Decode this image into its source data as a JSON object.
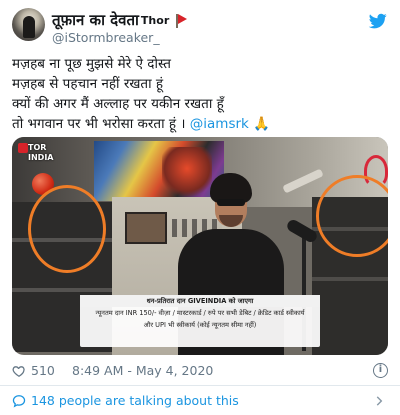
{
  "author": {
    "display_name": "तूफ़ान का देवता",
    "name_suffix": "Thor",
    "handle": "@iStormbreaker_"
  },
  "tweet": {
    "lines": [
      "मज़हब ना पूछ मुझसे मेरे ऐ दोस्त",
      "मज़हब से पहचान नहीं रखता हूं",
      "क्यों की अगर मैं अल्लाह पर यकीन रखता हूँ",
      "तो भगवान पर भी भरोसा करता हूं । "
    ],
    "mention": "@iamsrk",
    "emoji": "🙏"
  },
  "media": {
    "channel_logo": "TOR INDIA",
    "caption_lines": [
      "धन-प्रतिरात दान GIVEINDIA को जाएगा",
      "न्यूनतम दान INR 150/- वीज़ा / मास्टरकार्ड / रुपे पर सभी डेबिट / क्रेडिट कार्ड स्वीकार्य",
      "और UPI भी स्वीकार्य (कोई न्यूनतम सीमा नहीं)"
    ],
    "highlight_color": "#ef7d27"
  },
  "meta": {
    "like_count": "510",
    "timestamp": "8:49 AM - May 4, 2020"
  },
  "footer": {
    "talk_text": "148 people are talking about this"
  },
  "colors": {
    "link": "#1b95e0",
    "secondary_text": "#657786",
    "divider": "#e1e8ed"
  },
  "icons": [
    "avatar",
    "red-flag-icon",
    "twitter-bird-icon",
    "heart-icon",
    "info-icon",
    "speech-bubble-icon",
    "chevron-right-icon"
  ]
}
